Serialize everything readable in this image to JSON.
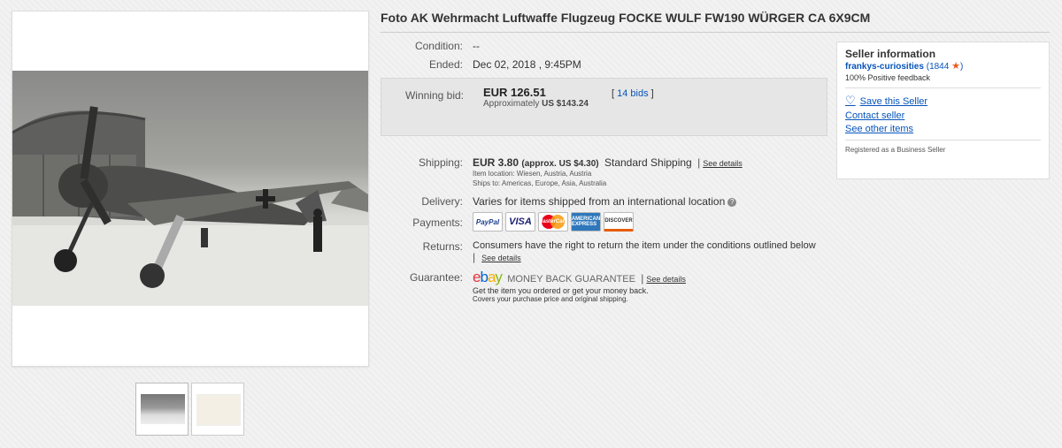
{
  "title": "Foto AK Wehrmacht Luftwaffe Flugzeug FOCKE WULF FW190 WÜRGER CA 6X9CM",
  "condition": {
    "label": "Condition:",
    "value": "--"
  },
  "ended": {
    "label": "Ended:",
    "value": "Dec 02, 2018 , 9:45PM"
  },
  "bid": {
    "label": "Winning bid:",
    "amount": "EUR 126.51",
    "approx_prefix": "Approximately",
    "approx_value": "US $143.24",
    "bids_open": "[",
    "bids_link": "14 bids",
    "bids_close": "]"
  },
  "shipping": {
    "label": "Shipping:",
    "amount": "EUR 3.80",
    "approx": "(approx. US $4.30)",
    "service": "Standard Shipping",
    "see_details": "See details",
    "item_location": "Item location:  Wiesen, Austria, Austria",
    "ships_to": "Ships to:  Americas, Europe, Asia, Australia"
  },
  "delivery": {
    "label": "Delivery:",
    "value": "Varies for items shipped from an international location"
  },
  "payments": {
    "label": "Payments:",
    "methods": [
      {
        "name": "PayPal"
      },
      {
        "name": "VISA"
      },
      {
        "name": "MasterCard"
      },
      {
        "name": "AMERICAN EXPRESS"
      },
      {
        "name": "DISCOVER"
      }
    ]
  },
  "returns": {
    "label": "Returns:",
    "value": "Consumers have the right to return the item under the conditions outlined below",
    "see_details": "See details"
  },
  "guarantee": {
    "label": "Guarantee:",
    "logo": {
      "e": "e",
      "b": "b",
      "a": "a",
      "y": "y"
    },
    "program": "MONEY BACK GUARANTEE",
    "see_details": "See details",
    "line1": "Get the item you ordered or get your money back.",
    "line2": "Covers your purchase price and original shipping."
  },
  "seller": {
    "heading": "Seller information",
    "name": "frankys-curiosities",
    "score_open": "(",
    "score": "1844",
    "score_close": ")",
    "feedback": "100% Positive feedback",
    "save": "Save this Seller",
    "contact": "Contact seller",
    "other_items": "See other items",
    "business": "Registered as a Business Seller"
  },
  "colors": {
    "link": "#0654ba",
    "star": "#e85a1e"
  }
}
